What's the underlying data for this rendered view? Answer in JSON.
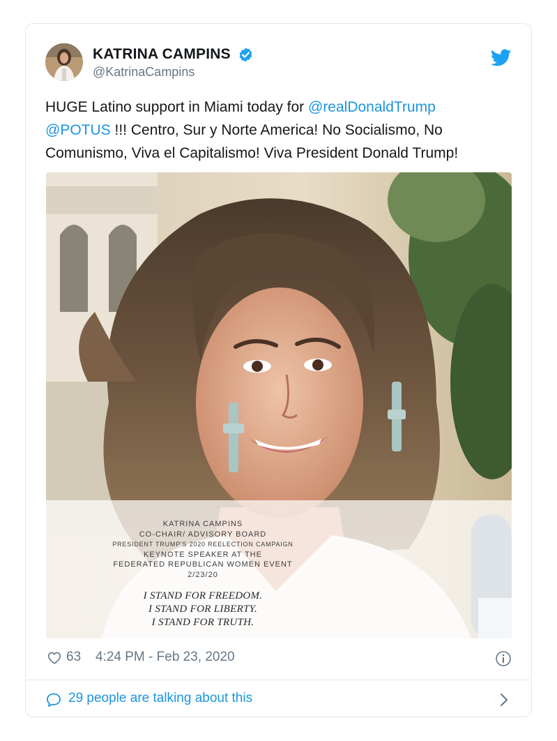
{
  "user": {
    "display_name": "KATRINA CAMPINS",
    "handle": "@KatrinaCampins",
    "verified": true
  },
  "tweet": {
    "text_part1": "HUGE Latino support in Miami today for ",
    "mention1": "@realDonaldTrump",
    "mention2": "@POTUS",
    "text_part2": " !!! Centro, Sur y Norte America! No Socialismo, No Comunismo, Viva el Capitalismo! Viva President Donald Trump!"
  },
  "photo_overlay": {
    "line1": "KATRINA CAMPINS",
    "line2": "CO-CHAIR/ ADVISORY BOARD",
    "line3": "PRESIDENT TRUMP'S 2020 REELECTION CAMPAIGN",
    "line4": "KEYNOTE SPEAKER AT THE",
    "line5": "FEDERATED REPUBLICAN WOMEN EVENT",
    "line6": "2/23/20",
    "slogan1": "I STAND FOR FREEDOM.",
    "slogan2": "I STAND FOR LIBERTY.",
    "slogan3": "I STAND FOR TRUTH."
  },
  "footer": {
    "likes": "63",
    "timestamp": "4:24 PM - Feb 23, 2020"
  },
  "conversation": {
    "label": "29 people are talking about this"
  },
  "colors": {
    "link": "#1b95e0",
    "muted": "#657786",
    "border": "#e1e8ed",
    "text": "#14171a"
  },
  "icons": [
    "verified-badge-icon",
    "twitter-bird-icon",
    "heart-icon",
    "info-icon",
    "speech-bubble-icon",
    "chevron-right-icon"
  ]
}
